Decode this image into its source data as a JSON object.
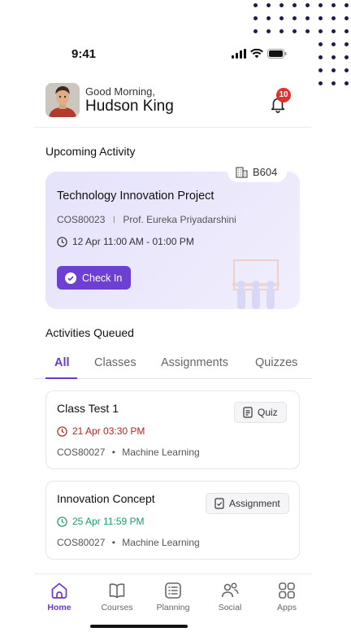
{
  "status_bar": {
    "time": "9:41"
  },
  "header": {
    "greeting": "Good Morning,",
    "user_name": "Hudson King",
    "notification_count": "10"
  },
  "upcoming": {
    "section_title": "Upcoming Activity",
    "room": "B604",
    "title": "Technology Innovation Project",
    "course_code": "COS80023",
    "separator": "I",
    "professor": "Prof. Eureka Priyadarshini",
    "time": "12 Apr 11:00 AM - 01:00 PM",
    "checkin_label": "Check In"
  },
  "queued": {
    "section_title": "Activities Queued",
    "tabs": [
      "All",
      "Classes",
      "Assignments",
      "Quizzes"
    ],
    "active_tab": "All",
    "items": [
      {
        "title": "Class Test 1",
        "date": "21 Apr 03:30 PM",
        "date_status": "overdue",
        "course": "COS80027",
        "subject": "Machine Learning",
        "type": "Quiz"
      },
      {
        "title": "Innovation Concept",
        "date": "25 Apr 11:59 PM",
        "date_status": "upcoming",
        "course": "COS80027",
        "subject": "Machine Learning",
        "type": "Assignment"
      }
    ]
  },
  "bottom_nav": {
    "items": [
      {
        "label": "Home",
        "icon": "home-icon",
        "active": true
      },
      {
        "label": "Courses",
        "icon": "book-icon",
        "active": false
      },
      {
        "label": "Planning",
        "icon": "list-icon",
        "active": false
      },
      {
        "label": "Social",
        "icon": "people-icon",
        "active": false
      },
      {
        "label": "Apps",
        "icon": "grid-icon",
        "active": false
      }
    ]
  },
  "colors": {
    "accent": "#6b36d8",
    "button": "#6d3fd3",
    "badge": "#e0312b",
    "overdue": "#b3261e",
    "upcoming": "#1b9b6d",
    "decor_dots": "#1f1d4d"
  }
}
